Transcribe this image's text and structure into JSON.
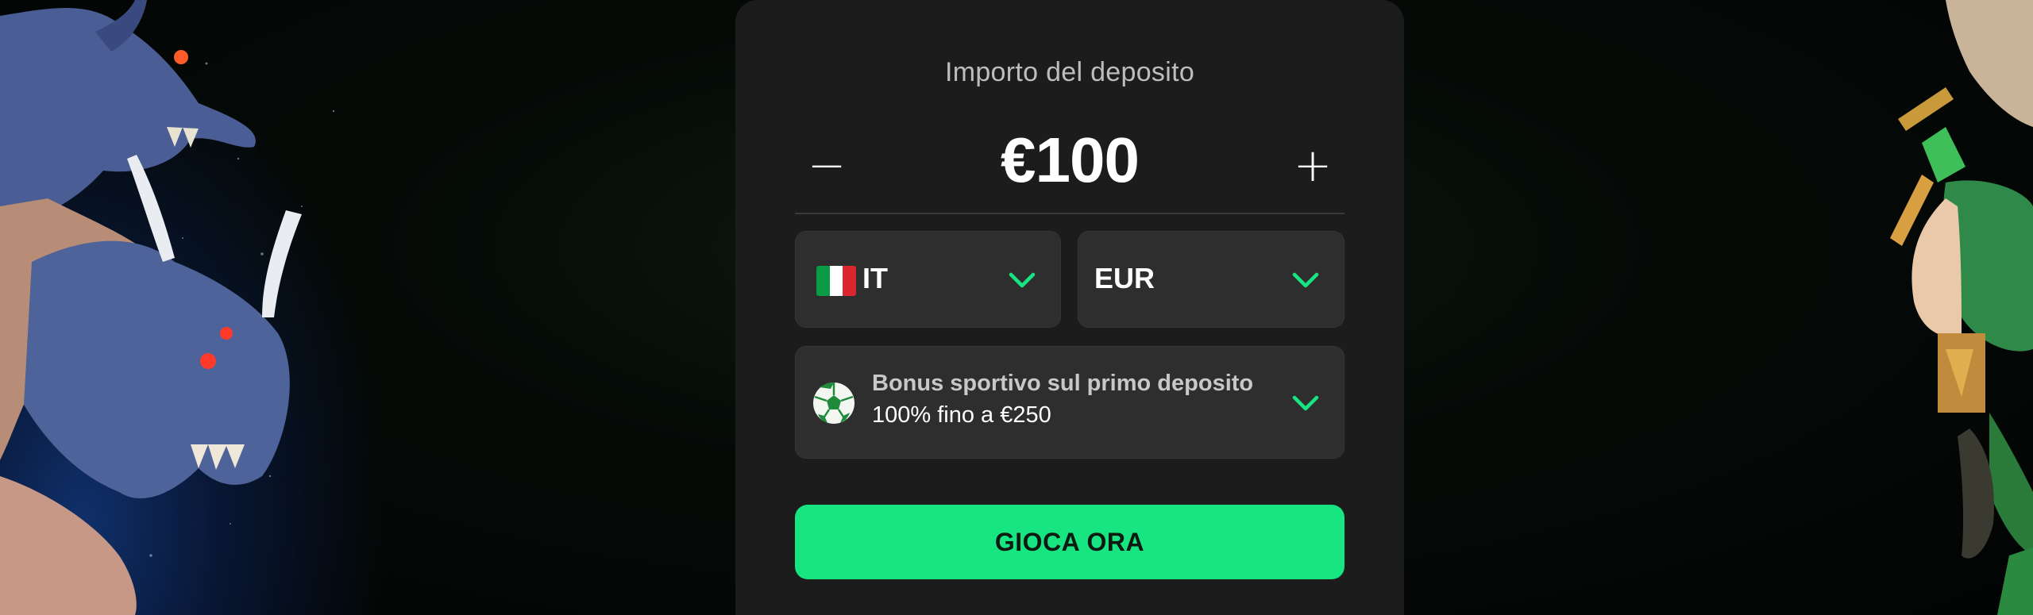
{
  "deposit": {
    "title": "Importo del deposito",
    "minus_symbol": "−",
    "plus_symbol": "+",
    "amount": "€100"
  },
  "country_select": {
    "value": "IT",
    "flag_icon": "italy-flag-icon"
  },
  "currency_select": {
    "value": "EUR"
  },
  "bonus": {
    "icon": "soccer-ball-icon",
    "title": "Bonus sportivo sul primo deposito",
    "subtitle": "100% fino a €250"
  },
  "cta": {
    "label": "GIOCA ORA"
  },
  "colors": {
    "accent": "#17e582",
    "card": "#1c1c1c",
    "field": "#2e2e2e"
  }
}
